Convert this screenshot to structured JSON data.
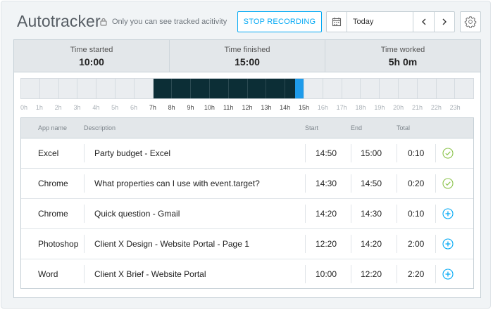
{
  "header": {
    "title": "Autotracker",
    "privacy_text": "Only you can see tracked acitivity",
    "stop_button_label": "STOP RECORDING",
    "date_value": "Today"
  },
  "stats": [
    {
      "label": "Time started",
      "value": "10:00"
    },
    {
      "label": "Time finished",
      "value": "15:00"
    },
    {
      "label": "Time worked",
      "value": "5h 0m"
    }
  ],
  "timeline": {
    "hours": [
      "0h",
      "1h",
      "2h",
      "3h",
      "4h",
      "5h",
      "6h",
      "7h",
      "8h",
      "9h",
      "10h",
      "11h",
      "12h",
      "13h",
      "14h",
      "15h",
      "16h",
      "17h",
      "18h",
      "19h",
      "20h",
      "21h",
      "22h",
      "23h"
    ],
    "tracked_start_hour": 7,
    "tracked_end_hour": 14.55,
    "recording_end_hour": 15,
    "highlighted_hours": [
      "7h",
      "8h",
      "9h",
      "10h",
      "11h",
      "12h",
      "13h",
      "14h",
      "15h"
    ]
  },
  "table": {
    "headers": {
      "app": "App name",
      "description": "Description",
      "start": "Start",
      "end": "End",
      "total": "Total"
    },
    "rows": [
      {
        "app": "Excel",
        "description": "Party budget - Excel",
        "start": "14:50",
        "end": "15:00",
        "total": "0:10",
        "status": "check"
      },
      {
        "app": "Chrome",
        "description": "What properties can I use with event.target?",
        "start": "14:30",
        "end": "14:50",
        "total": "0:20",
        "status": "check"
      },
      {
        "app": "Chrome",
        "description": "Quick question - Gmail",
        "start": "14:20",
        "end": "14:30",
        "total": "0:10",
        "status": "add"
      },
      {
        "app": "Photoshop",
        "description": "Client X Design - Website Portal - Page 1",
        "start": "12:20",
        "end": "14:20",
        "total": "2:00",
        "status": "add"
      },
      {
        "app": "Word",
        "description": "Client X Brief - Website Portal",
        "start": "10:00",
        "end": "12:20",
        "total": "2:20",
        "status": "add"
      }
    ]
  },
  "colors": {
    "accent": "#03a9f4",
    "tracked": "#0c2e36",
    "recording": "#1e9bea",
    "check": "#8bc34a",
    "add": "#03a9f4"
  }
}
